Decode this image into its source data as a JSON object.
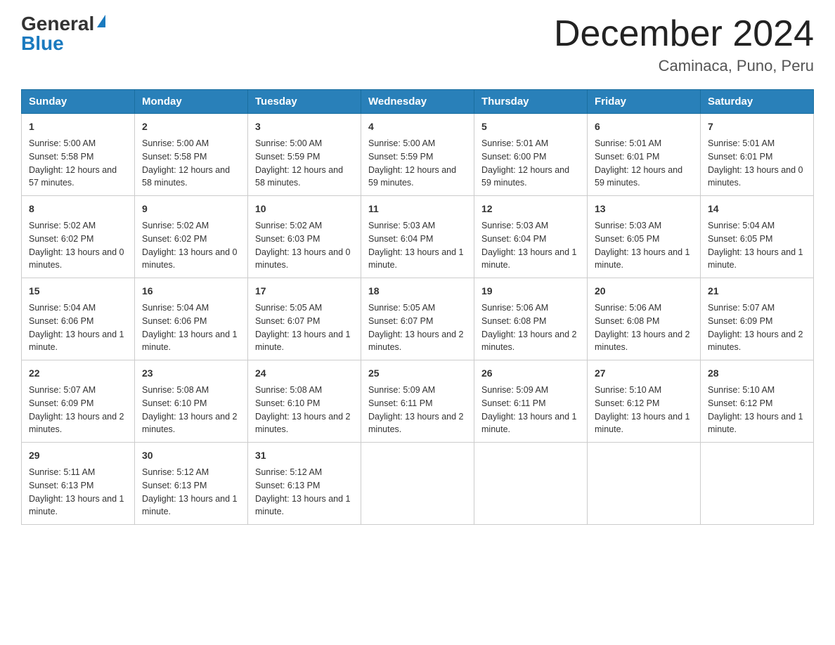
{
  "header": {
    "logo_general": "General",
    "logo_blue": "Blue",
    "month_title": "December 2024",
    "location": "Caminaca, Puno, Peru"
  },
  "days": [
    "Sunday",
    "Monday",
    "Tuesday",
    "Wednesday",
    "Thursday",
    "Friday",
    "Saturday"
  ],
  "weeks": [
    [
      {
        "day": "1",
        "sunrise": "5:00 AM",
        "sunset": "5:58 PM",
        "daylight": "12 hours and 57 minutes."
      },
      {
        "day": "2",
        "sunrise": "5:00 AM",
        "sunset": "5:58 PM",
        "daylight": "12 hours and 58 minutes."
      },
      {
        "day": "3",
        "sunrise": "5:00 AM",
        "sunset": "5:59 PM",
        "daylight": "12 hours and 58 minutes."
      },
      {
        "day": "4",
        "sunrise": "5:00 AM",
        "sunset": "5:59 PM",
        "daylight": "12 hours and 59 minutes."
      },
      {
        "day": "5",
        "sunrise": "5:01 AM",
        "sunset": "6:00 PM",
        "daylight": "12 hours and 59 minutes."
      },
      {
        "day": "6",
        "sunrise": "5:01 AM",
        "sunset": "6:01 PM",
        "daylight": "12 hours and 59 minutes."
      },
      {
        "day": "7",
        "sunrise": "5:01 AM",
        "sunset": "6:01 PM",
        "daylight": "13 hours and 0 minutes."
      }
    ],
    [
      {
        "day": "8",
        "sunrise": "5:02 AM",
        "sunset": "6:02 PM",
        "daylight": "13 hours and 0 minutes."
      },
      {
        "day": "9",
        "sunrise": "5:02 AM",
        "sunset": "6:02 PM",
        "daylight": "13 hours and 0 minutes."
      },
      {
        "day": "10",
        "sunrise": "5:02 AM",
        "sunset": "6:03 PM",
        "daylight": "13 hours and 0 minutes."
      },
      {
        "day": "11",
        "sunrise": "5:03 AM",
        "sunset": "6:04 PM",
        "daylight": "13 hours and 1 minute."
      },
      {
        "day": "12",
        "sunrise": "5:03 AM",
        "sunset": "6:04 PM",
        "daylight": "13 hours and 1 minute."
      },
      {
        "day": "13",
        "sunrise": "5:03 AM",
        "sunset": "6:05 PM",
        "daylight": "13 hours and 1 minute."
      },
      {
        "day": "14",
        "sunrise": "5:04 AM",
        "sunset": "6:05 PM",
        "daylight": "13 hours and 1 minute."
      }
    ],
    [
      {
        "day": "15",
        "sunrise": "5:04 AM",
        "sunset": "6:06 PM",
        "daylight": "13 hours and 1 minute."
      },
      {
        "day": "16",
        "sunrise": "5:04 AM",
        "sunset": "6:06 PM",
        "daylight": "13 hours and 1 minute."
      },
      {
        "day": "17",
        "sunrise": "5:05 AM",
        "sunset": "6:07 PM",
        "daylight": "13 hours and 1 minute."
      },
      {
        "day": "18",
        "sunrise": "5:05 AM",
        "sunset": "6:07 PM",
        "daylight": "13 hours and 2 minutes."
      },
      {
        "day": "19",
        "sunrise": "5:06 AM",
        "sunset": "6:08 PM",
        "daylight": "13 hours and 2 minutes."
      },
      {
        "day": "20",
        "sunrise": "5:06 AM",
        "sunset": "6:08 PM",
        "daylight": "13 hours and 2 minutes."
      },
      {
        "day": "21",
        "sunrise": "5:07 AM",
        "sunset": "6:09 PM",
        "daylight": "13 hours and 2 minutes."
      }
    ],
    [
      {
        "day": "22",
        "sunrise": "5:07 AM",
        "sunset": "6:09 PM",
        "daylight": "13 hours and 2 minutes."
      },
      {
        "day": "23",
        "sunrise": "5:08 AM",
        "sunset": "6:10 PM",
        "daylight": "13 hours and 2 minutes."
      },
      {
        "day": "24",
        "sunrise": "5:08 AM",
        "sunset": "6:10 PM",
        "daylight": "13 hours and 2 minutes."
      },
      {
        "day": "25",
        "sunrise": "5:09 AM",
        "sunset": "6:11 PM",
        "daylight": "13 hours and 2 minutes."
      },
      {
        "day": "26",
        "sunrise": "5:09 AM",
        "sunset": "6:11 PM",
        "daylight": "13 hours and 1 minute."
      },
      {
        "day": "27",
        "sunrise": "5:10 AM",
        "sunset": "6:12 PM",
        "daylight": "13 hours and 1 minute."
      },
      {
        "day": "28",
        "sunrise": "5:10 AM",
        "sunset": "6:12 PM",
        "daylight": "13 hours and 1 minute."
      }
    ],
    [
      {
        "day": "29",
        "sunrise": "5:11 AM",
        "sunset": "6:13 PM",
        "daylight": "13 hours and 1 minute."
      },
      {
        "day": "30",
        "sunrise": "5:12 AM",
        "sunset": "6:13 PM",
        "daylight": "13 hours and 1 minute."
      },
      {
        "day": "31",
        "sunrise": "5:12 AM",
        "sunset": "6:13 PM",
        "daylight": "13 hours and 1 minute."
      },
      null,
      null,
      null,
      null
    ]
  ]
}
